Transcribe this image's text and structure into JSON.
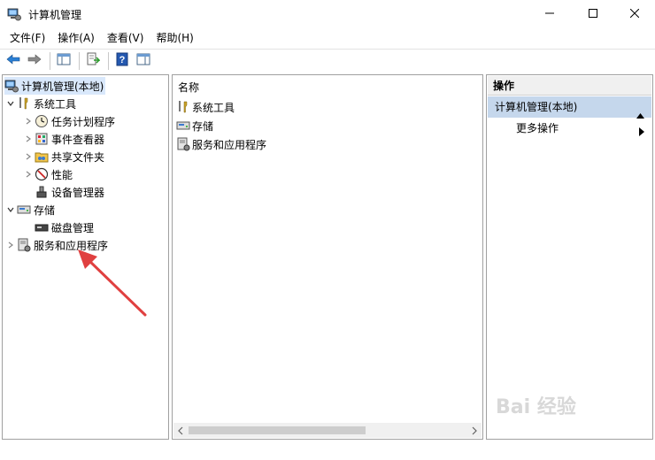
{
  "window": {
    "title": "计算机管理",
    "minimize_icon": "minimize-icon",
    "maximize_icon": "maximize-icon",
    "close_icon": "close-icon"
  },
  "menu": [
    "文件(F)",
    "操作(A)",
    "查看(V)",
    "帮助(H)"
  ],
  "toolbar": {
    "buttons": [
      "back-arrow-icon",
      "forward-arrow-icon",
      "show-hide-console-tree-icon",
      "export-list-icon",
      "help-icon",
      "show-hide-action-pane-icon"
    ]
  },
  "tree": {
    "root": "计算机管理(本地)",
    "items": [
      {
        "label": "系统工具",
        "expanded": true
      },
      {
        "label": "任务计划程序"
      },
      {
        "label": "事件查看器"
      },
      {
        "label": "共享文件夹"
      },
      {
        "label": "性能"
      },
      {
        "label": "设备管理器"
      },
      {
        "label": "存储",
        "expanded": true
      },
      {
        "label": "磁盘管理"
      },
      {
        "label": "服务和应用程序",
        "expanded": false
      }
    ]
  },
  "list": {
    "header": "名称",
    "rows": [
      "系统工具",
      "存储",
      "服务和应用程序"
    ]
  },
  "actions": {
    "header": "操作",
    "section": "计算机管理(本地)",
    "item": "更多操作"
  },
  "watermark": "Bai 经验",
  "colors": {
    "selection": "#d9e8fb",
    "action_section": "#c5d7ec",
    "annotation_arrow": "#e04040"
  }
}
